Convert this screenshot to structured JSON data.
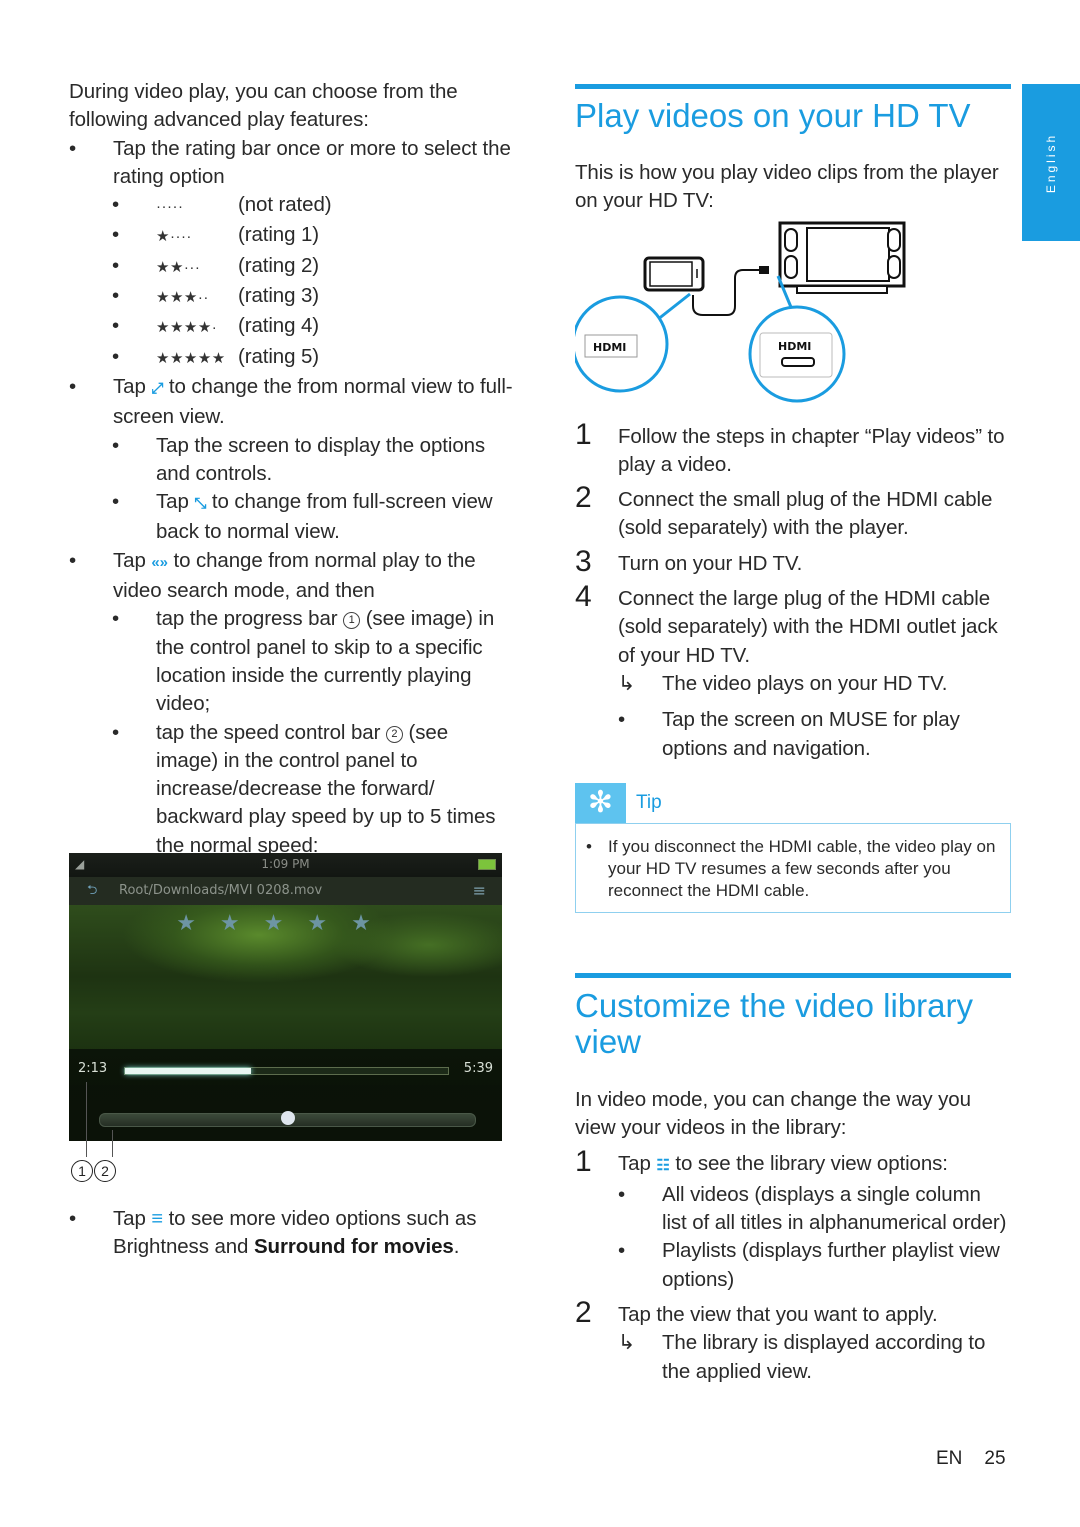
{
  "left_column": {
    "intro": "During video play, you can choose from the following advanced play features:",
    "rating_bullet": "Tap the rating bar once or more to select the rating option",
    "ratings": [
      {
        "stars": "·····",
        "label": "(not rated)"
      },
      {
        "stars": "★····",
        "label": "(rating 1)"
      },
      {
        "stars": "★★···",
        "label": "(rating 2)"
      },
      {
        "stars": "★★★··",
        "label": "(rating 3)"
      },
      {
        "stars": "★★★★·",
        "label": "(rating 4)"
      },
      {
        "stars": "★★★★★",
        "label": "(rating 5)"
      }
    ],
    "fullscreen_bullet": {
      "pre": "Tap",
      "icon": "⤢",
      "post": "to change the from normal view to full-screen view."
    },
    "fullscreen_sub": [
      {
        "text": "Tap the screen to display the options and controls."
      },
      {
        "pre": "Tap",
        "icon": "⤡",
        "post": "to change from full-screen view back to normal view."
      }
    ],
    "search_bullet": {
      "pre": "Tap",
      "icon": "«»",
      "post": "to change from normal play to the video search mode, and then"
    },
    "search_sub": [
      {
        "pre": "tap the progress bar",
        "callout": "1",
        "post": "(see image) in the control panel to skip to a specific location inside the currently playing video;"
      },
      {
        "pre": "tap the speed control bar",
        "callout": "2",
        "post": "(see image) in the control panel to increase/decrease the forward/ backward play speed by up to 5 times the normal speed:"
      }
    ],
    "video": {
      "clock": "1:09 PM",
      "path": "Root/Downloads/MVI 0208.mov",
      "rating_stars": "★★★★★",
      "elapsed": "2:13",
      "total": "5:39",
      "progress_fraction": 0.39,
      "speed_position_fraction": 0.5,
      "callouts": [
        "1",
        "2"
      ]
    },
    "options_bullet": {
      "pre": "Tap",
      "icon": "≡",
      "post": "to see more video options such as Brightness and",
      "bold": "Surround for movies",
      "end": "."
    }
  },
  "right_column": {
    "section1": {
      "title": "Play videos on your HD TV",
      "intro": "This is how you play video clips from the player on your HD TV:",
      "diagram": {
        "left_label": "HDMI",
        "right_label": "HDMI"
      },
      "steps": [
        {
          "n": "1",
          "text": "Follow the steps in chapter “Play videos” to play a video."
        },
        {
          "n": "2",
          "text": "Connect the small plug of the HDMI cable (sold separately) with the player."
        },
        {
          "n": "3",
          "text": "Turn on your HD TV."
        },
        {
          "n": "4",
          "text": "Connect the large plug of the HDMI cable (sold separately) with the HDMI outlet jack of your HD TV."
        }
      ],
      "result": "The video plays on your HD TV.",
      "result_arrow": "↳",
      "note": "Tap the screen on MUSE for play options and navigation.",
      "tip": {
        "icon": "✻",
        "label": "Tip",
        "text": "If you disconnect the HDMI cable, the video play on your HD TV resumes a few seconds after you reconnect the HDMI cable."
      }
    },
    "section2": {
      "title": "Customize the video library view",
      "intro": "In video mode, you can change the way you view your videos in the library:",
      "step1": {
        "n": "1",
        "pre": "Tap",
        "icon": "☷",
        "post": "to see the library view options:"
      },
      "options": [
        "All videos (displays a single column list of all titles in alphanumerical order)",
        "Playlists (displays further playlist view options)"
      ],
      "step2": {
        "n": "2",
        "text": "Tap the view that you want to apply."
      },
      "result": "The library is displayed according to the applied view.",
      "result_arrow": "↳"
    }
  },
  "side_tab": {
    "label": "English"
  },
  "footer": {
    "lang": "EN",
    "page": "25"
  },
  "colors": {
    "accent": "#1a9ce0",
    "tip_icon_bg": "#5ec3ef",
    "tip_border": "#8fd0ef"
  }
}
